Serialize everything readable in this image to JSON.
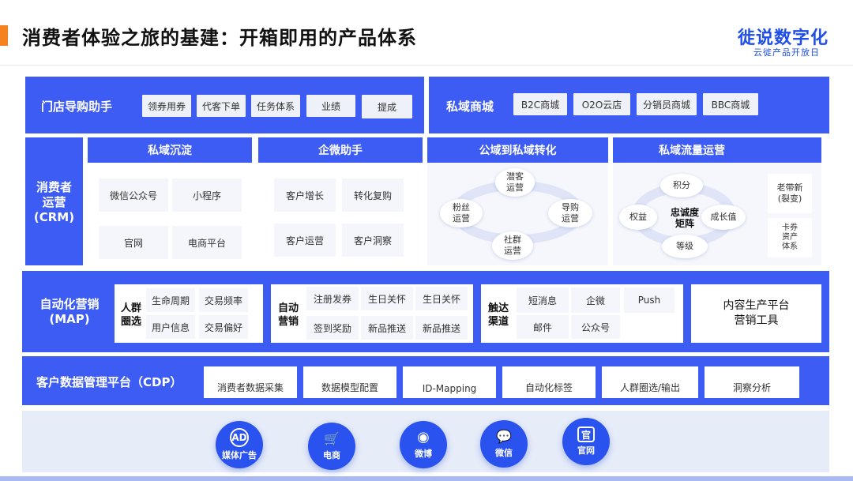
{
  "header": {
    "title": "消费者体验之旅的基建：开箱即用的产品体系",
    "logo_main": "徙说数字化",
    "logo_sub": "云徙产品开放日"
  },
  "store_guide": {
    "title": "门店导购助手",
    "items": [
      "领券用券",
      "代客下单",
      "任务体系",
      "业绩",
      "提成"
    ]
  },
  "private_mall": {
    "title": "私域商城",
    "items": [
      "B2C商城",
      "O2O云店",
      "分销员商城",
      "BBC商城"
    ]
  },
  "crm": {
    "label_line1": "消费者",
    "label_line2": "运营",
    "label_line3": "(CRM)",
    "private_deposit": {
      "title": "私域沉淀",
      "items": [
        "微信公众号",
        "小程序",
        "官网",
        "电商平台"
      ]
    },
    "wecom_assistant": {
      "title": "企微助手",
      "items": [
        "客户增长",
        "转化复购",
        "客户运营",
        "客户洞察"
      ]
    },
    "public_to_private": {
      "title": "公域到私域转化",
      "top_l1": "潜客",
      "top_l2": "运营",
      "left_l1": "粉丝",
      "left_l2": "运营",
      "right_l1": "导购",
      "right_l2": "运营",
      "bottom_l1": "社群",
      "bottom_l2": "运营"
    },
    "private_traffic": {
      "title": "私域流量运营",
      "top": "积分",
      "left": "权益",
      "right": "成长值",
      "bottom": "等级",
      "center_l1": "忠诚度",
      "center_l2": "矩阵",
      "side_1_l1": "老带新",
      "side_1_l2": "(裂变)",
      "side_2_l1": "卡券",
      "side_2_l2": "资产",
      "side_2_l3": "体系"
    }
  },
  "map": {
    "label_line1": "自动化营销",
    "label_line2": "(MAP)",
    "crowd": {
      "label_l1": "人群",
      "label_l2": "圈选",
      "items": [
        "生命周期",
        "交易频率",
        "用户信息",
        "交易偏好"
      ]
    },
    "auto": {
      "label_l1": "自动",
      "label_l2": "营销",
      "items": [
        "注册发券",
        "生日关怀",
        "生日关怀",
        "签到奖励",
        "新品推送",
        "新品推送"
      ]
    },
    "channel": {
      "label_l1": "触达",
      "label_l2": "渠道",
      "items": [
        "短消息",
        "企微",
        "Push",
        "邮件",
        "公众号"
      ]
    },
    "content_l1": "内容生产平台",
    "content_l2": "营销工具"
  },
  "cdp": {
    "title": "客户数据管理平台（CDP）",
    "items": [
      "消费者数据采集",
      "数据模型配置",
      "ID-Mapping",
      "自动化标签",
      "人群圈选/输出",
      "洞察分析"
    ]
  },
  "sources": {
    "items": [
      {
        "icon": "ad-icon",
        "glyph": "AD",
        "label": "媒体广告"
      },
      {
        "icon": "shopping-cart-icon",
        "glyph": "🛒",
        "label": "电商"
      },
      {
        "icon": "weibo-icon",
        "glyph": "◉",
        "label": "微博"
      },
      {
        "icon": "wechat-icon",
        "glyph": "💬",
        "label": "微信"
      },
      {
        "icon": "website-icon",
        "glyph": "官",
        "label": "官网"
      }
    ]
  },
  "colors": {
    "primary": "#3d5cf3",
    "accent": "#f5821f",
    "logo": "#1f4ee8"
  }
}
